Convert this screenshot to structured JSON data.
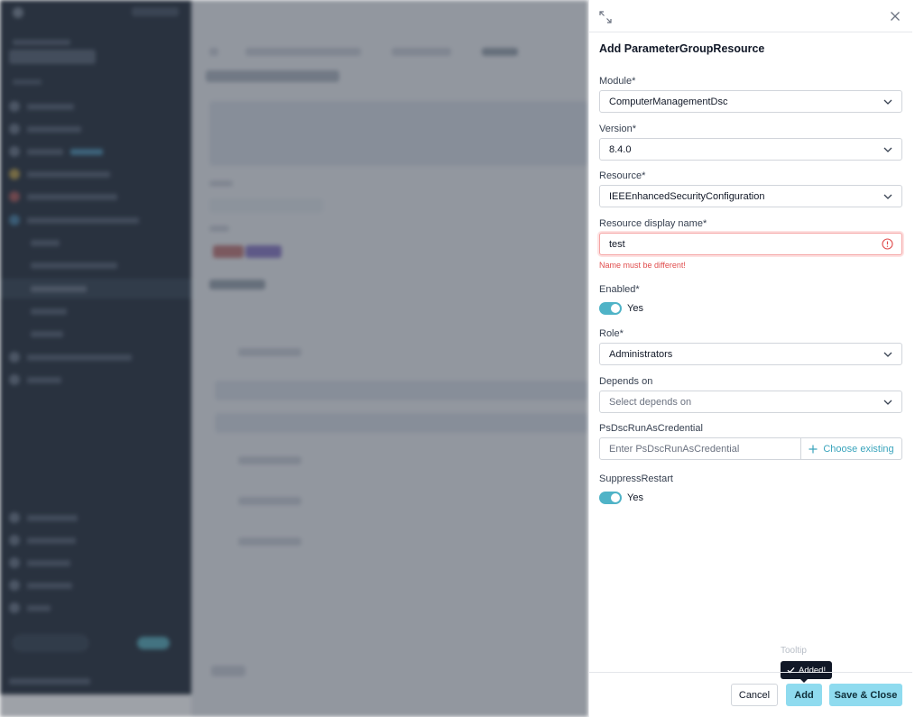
{
  "panel": {
    "title": "Add ParameterGroupResource",
    "expand_icon": "expand-icon",
    "close_icon": "close-icon"
  },
  "form": {
    "module": {
      "label": "Module*",
      "value": "ComputerManagementDsc"
    },
    "version": {
      "label": "Version*",
      "value": "8.4.0"
    },
    "resource": {
      "label": "Resource*",
      "value": "IEEEnhancedSecurityConfiguration"
    },
    "display_name": {
      "label": "Resource display name*",
      "value": "test",
      "error": "Name must be different!"
    },
    "enabled": {
      "label": "Enabled*",
      "state": "Yes",
      "on": true
    },
    "role": {
      "label": "Role*",
      "value": "Administrators"
    },
    "depends_on": {
      "label": "Depends on",
      "placeholder": "Select depends on"
    },
    "ps_credential": {
      "label": "PsDscRunAsCredential",
      "placeholder": "Enter PsDscRunAsCredential",
      "button": "Choose existing"
    },
    "suppress_restart": {
      "label": "SuppressRestart",
      "state": "Yes",
      "on": true
    }
  },
  "tooltip": {
    "caption": "Tooltip",
    "text": "Added!"
  },
  "footer": {
    "cancel": "Cancel",
    "add": "Add",
    "save_close": "Save & Close"
  },
  "colors": {
    "accent": "#4fb3c7",
    "primary_button": "#8fdbef",
    "error": "#e04d4d"
  }
}
